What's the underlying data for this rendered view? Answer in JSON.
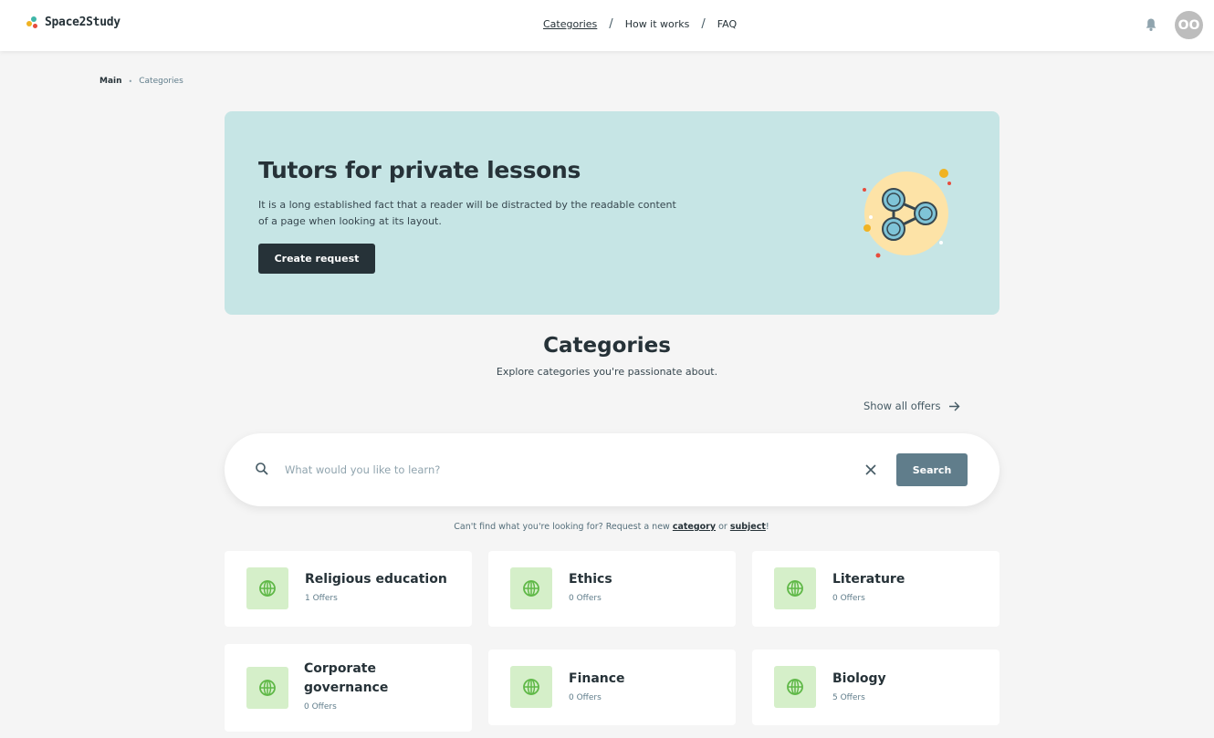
{
  "header": {
    "logo_text": "Space2Study",
    "nav": [
      {
        "label": "Categories",
        "active": true
      },
      {
        "label": "How it works",
        "active": false
      },
      {
        "label": "FAQ",
        "active": false
      }
    ],
    "separator": "/",
    "avatar_initials": "OO"
  },
  "breadcrumb": {
    "main": "Main",
    "current": "Categories"
  },
  "hero": {
    "title": "Tutors for private lessons",
    "description": "It is a long established fact that a reader will be distracted by the readable content of a page when looking at its layout.",
    "button_label": "Create request",
    "illustration_icon": "share-nodes-icon"
  },
  "categories_section": {
    "title": "Categories",
    "subtitle": "Explore categories you're passionate about.",
    "show_all_label": "Show all offers"
  },
  "search": {
    "placeholder": "What would you like to learn?",
    "value": "",
    "button_label": "Search"
  },
  "request_line": {
    "prefix": "Can't find what you're looking for? Request a new ",
    "category_link": "category",
    "middle": " or ",
    "subject_link": "subject",
    "suffix": "!"
  },
  "categories": [
    {
      "name": "Religious education",
      "offers": "1 Offers",
      "icon": "globe-icon"
    },
    {
      "name": "Ethics",
      "offers": "0 Offers",
      "icon": "globe-icon"
    },
    {
      "name": "Literature",
      "offers": "0 Offers",
      "icon": "globe-icon"
    },
    {
      "name": "Corporate governance",
      "offers": "0 Offers",
      "icon": "globe-icon"
    },
    {
      "name": "Finance",
      "offers": "0 Offers",
      "icon": "globe-icon"
    },
    {
      "name": "Biology",
      "offers": "5 Offers",
      "icon": "globe-icon"
    }
  ],
  "colors": {
    "hero_bg": "#c6e5e5",
    "primary_dark": "#263238",
    "search_button": "#607d8b",
    "category_icon_bg": "#d5efc9",
    "category_icon": "#5fb847"
  }
}
